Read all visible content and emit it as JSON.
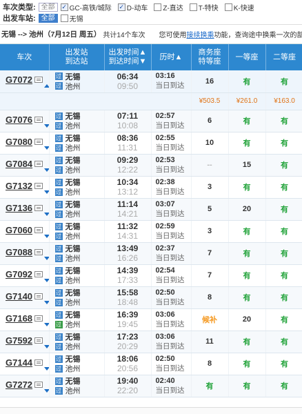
{
  "filters": {
    "type_label": "车次类型:",
    "all_label": "全部",
    "types": [
      {
        "label": "GC-高铁/城际",
        "checked": true
      },
      {
        "label": "D-动车",
        "checked": true
      },
      {
        "label": "Z-直达",
        "checked": false
      },
      {
        "label": "T-特快",
        "checked": false
      },
      {
        "label": "K-快速",
        "checked": false
      }
    ],
    "station_label": "出发车站:",
    "station_all_label": "全部",
    "stations": [
      {
        "label": "无锡",
        "checked": false
      }
    ]
  },
  "info": {
    "route": "无锡 --> 池州（7月12日  周五）",
    "count": "共计14个车次",
    "hint_before": "您可使用",
    "hint_link": "接续换乘",
    "hint_after": "功能，查询途中换乘一次的部分"
  },
  "headers": {
    "train": "车次",
    "stations_1": "出发站",
    "stations_2": "到达站",
    "time_1": "出发时间▲",
    "time_2": "到达时间▼",
    "duration": "历时▲",
    "business_1": "商务座",
    "business_2": "特等座",
    "first": "一等座",
    "second": "二等座"
  },
  "price_row": {
    "business": "¥503.5",
    "first": "¥261.0",
    "second": "¥163.0"
  },
  "trains": [
    {
      "no": "G7072",
      "from": "无锡",
      "to": "池州",
      "dep": "06:34",
      "arr": "09:50",
      "dur": "03:16",
      "arrive": "当日到达",
      "business": "16",
      "first": "有",
      "second": "有",
      "expanded": true
    },
    {
      "no": "G7076",
      "from": "无锡",
      "to": "池州",
      "dep": "07:11",
      "arr": "10:08",
      "dur": "02:57",
      "arrive": "当日到达",
      "business": "6",
      "first": "有",
      "second": "有"
    },
    {
      "no": "G7080",
      "from": "无锡",
      "to": "池州",
      "dep": "08:36",
      "arr": "11:31",
      "dur": "02:55",
      "arrive": "当日到达",
      "business": "10",
      "first": "有",
      "second": "有"
    },
    {
      "no": "G7084",
      "from": "无锡",
      "to": "池州",
      "dep": "09:29",
      "arr": "12:22",
      "dur": "02:53",
      "arrive": "当日到达",
      "business": "--",
      "first": "15",
      "second": "有"
    },
    {
      "no": "G7132",
      "from": "无锡",
      "to": "池州",
      "dep": "10:34",
      "arr": "13:12",
      "dur": "02:38",
      "arrive": "当日到达",
      "business": "3",
      "first": "有",
      "second": "有"
    },
    {
      "no": "G7136",
      "from": "无锡",
      "to": "池州",
      "dep": "11:14",
      "arr": "14:21",
      "dur": "03:07",
      "arrive": "当日到达",
      "business": "5",
      "first": "20",
      "second": "有"
    },
    {
      "no": "G7060",
      "from": "无锡",
      "to": "池州",
      "dep": "11:32",
      "arr": "14:31",
      "dur": "02:59",
      "arrive": "当日到达",
      "business": "3",
      "first": "有",
      "second": "有"
    },
    {
      "no": "G7088",
      "from": "无锡",
      "to": "池州",
      "dep": "13:49",
      "arr": "16:26",
      "dur": "02:37",
      "arrive": "当日到达",
      "business": "7",
      "first": "有",
      "second": "有"
    },
    {
      "no": "G7092",
      "from": "无锡",
      "to": "池州",
      "dep": "14:39",
      "arr": "17:33",
      "dur": "02:54",
      "arrive": "当日到达",
      "business": "7",
      "first": "有",
      "second": "有"
    },
    {
      "no": "G7140",
      "from": "无锡",
      "to": "池州",
      "dep": "15:58",
      "arr": "18:48",
      "dur": "02:50",
      "arrive": "当日到达",
      "business": "8",
      "first": "有",
      "second": "有"
    },
    {
      "no": "G7168",
      "from": "无锡",
      "to": "池州",
      "dep": "16:39",
      "arr": "19:45",
      "dur": "03:06",
      "arrive": "当日到达",
      "business": "候补",
      "first": "20",
      "second": "有",
      "endgreen": true
    },
    {
      "no": "G7592",
      "from": "无锡",
      "to": "池州",
      "dep": "17:23",
      "arr": "20:29",
      "dur": "03:06",
      "arrive": "当日到达",
      "business": "11",
      "first": "有",
      "second": "有"
    },
    {
      "no": "G7144",
      "from": "无锡",
      "to": "池州",
      "dep": "18:06",
      "arr": "20:56",
      "dur": "02:50",
      "arrive": "当日到达",
      "business": "8",
      "first": "有",
      "second": "有"
    },
    {
      "no": "G7272",
      "from": "无锡",
      "to": "池州",
      "dep": "19:40",
      "arr": "22:20",
      "dur": "02:40",
      "arrive": "当日到达",
      "business": "有",
      "first": "有",
      "second": "有"
    }
  ],
  "tags": {
    "start": "始",
    "pass": "过",
    "end": "终"
  },
  "colors": {
    "header_blue": "#2d88d0",
    "available_green": "#22a33a",
    "waitlist_orange": "#f59a23",
    "price_orange": "#e07214"
  }
}
